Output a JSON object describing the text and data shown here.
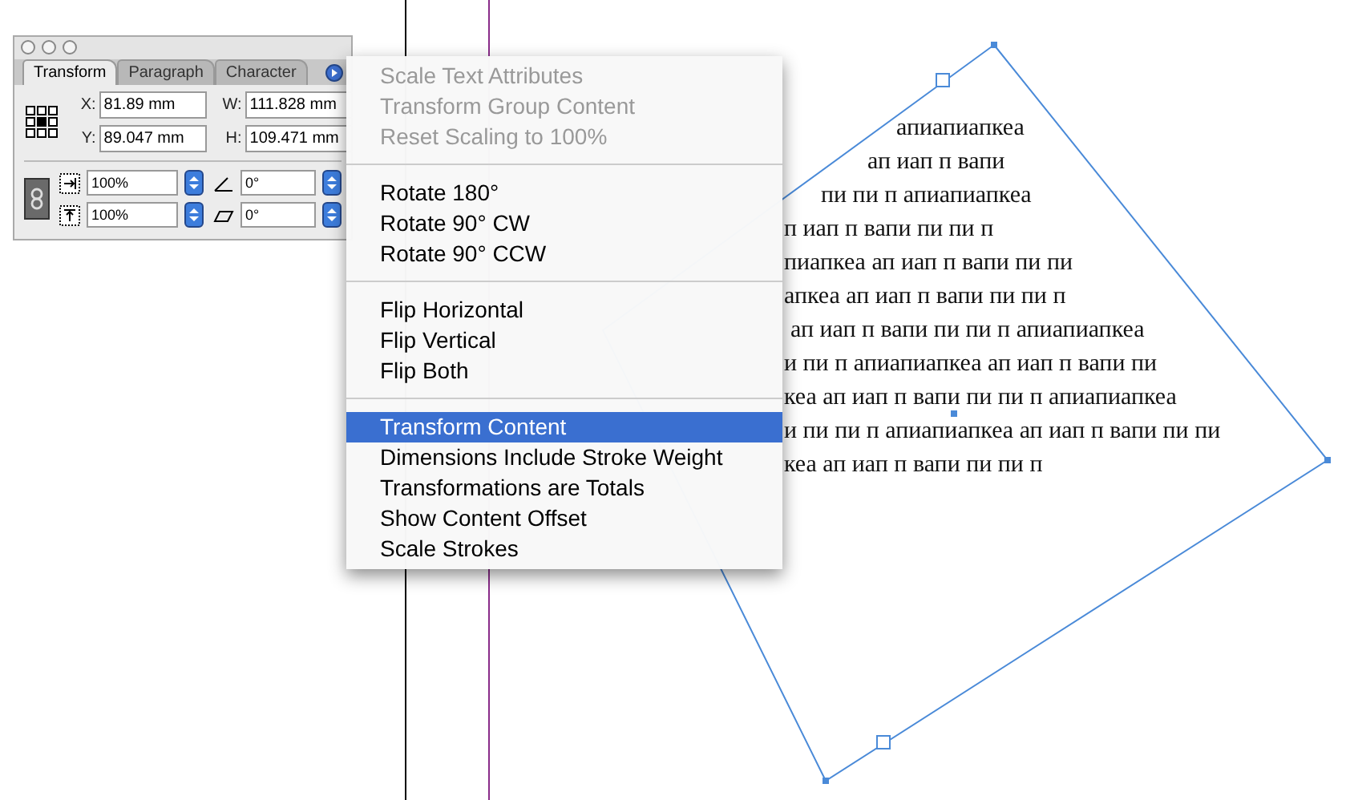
{
  "panel": {
    "tabs": [
      {
        "label": "Transform",
        "selected": true
      },
      {
        "label": "Paragraph",
        "selected": false
      },
      {
        "label": "Character",
        "selected": false
      }
    ],
    "position_fields": [
      {
        "label": "X:",
        "value": "81.89 mm"
      },
      {
        "label": "W:",
        "value": "111.828 mm"
      },
      {
        "label": "Y:",
        "value": "89.047 mm"
      },
      {
        "label": "H:",
        "value": "109.471 mm"
      }
    ],
    "scale_fields": [
      {
        "kind": "scale-x",
        "value": "100%"
      },
      {
        "kind": "rotate",
        "value": "0°"
      },
      {
        "kind": "scale-y",
        "value": "100%"
      },
      {
        "kind": "shear",
        "value": "0°"
      }
    ]
  },
  "menu": {
    "groups": [
      [
        {
          "label": "Scale Text Attributes",
          "disabled": true,
          "selected": false
        },
        {
          "label": "Transform Group Content",
          "disabled": true,
          "selected": false
        },
        {
          "label": "Reset Scaling to 100%",
          "disabled": true,
          "selected": false
        }
      ],
      [
        {
          "label": "Rotate 180°",
          "disabled": false,
          "selected": false
        },
        {
          "label": "Rotate 90° CW",
          "disabled": false,
          "selected": false
        },
        {
          "label": "Rotate 90° CCW",
          "disabled": false,
          "selected": false
        }
      ],
      [
        {
          "label": "Flip Horizontal",
          "disabled": false,
          "selected": false
        },
        {
          "label": "Flip Vertical",
          "disabled": false,
          "selected": false
        },
        {
          "label": "Flip Both",
          "disabled": false,
          "selected": false
        }
      ],
      [
        {
          "label": "Transform Content",
          "disabled": false,
          "selected": true
        },
        {
          "label": "Dimensions Include Stroke Weight",
          "disabled": false,
          "selected": false
        },
        {
          "label": "Transformations are Totals",
          "disabled": false,
          "selected": false
        },
        {
          "label": "Show Content Offset",
          "disabled": false,
          "selected": false
        },
        {
          "label": "Scale Strokes",
          "disabled": false,
          "selected": false
        }
      ]
    ]
  },
  "canvas_text": [
    "апиапиапкеа",
    "ап иап п вапи",
    "пи пи п апиапиапкеа",
    "п иап п вапи пи пи п",
    "пиапкеа ап иап п вапи пи пи",
    "апкеа ап иап п вапи пи пи п",
    "ап иап п вапи пи пи п апиапиапкеа",
    "и пи п апиапиапкеа ап иап п вапи пи",
    "кеа ап иап п вапи пи пи п апиапиапкеа",
    "и пи пи п апиапиапкеа ап иап п вапи пи пи",
    "кеа ап иап п вапи пи пи п"
  ]
}
